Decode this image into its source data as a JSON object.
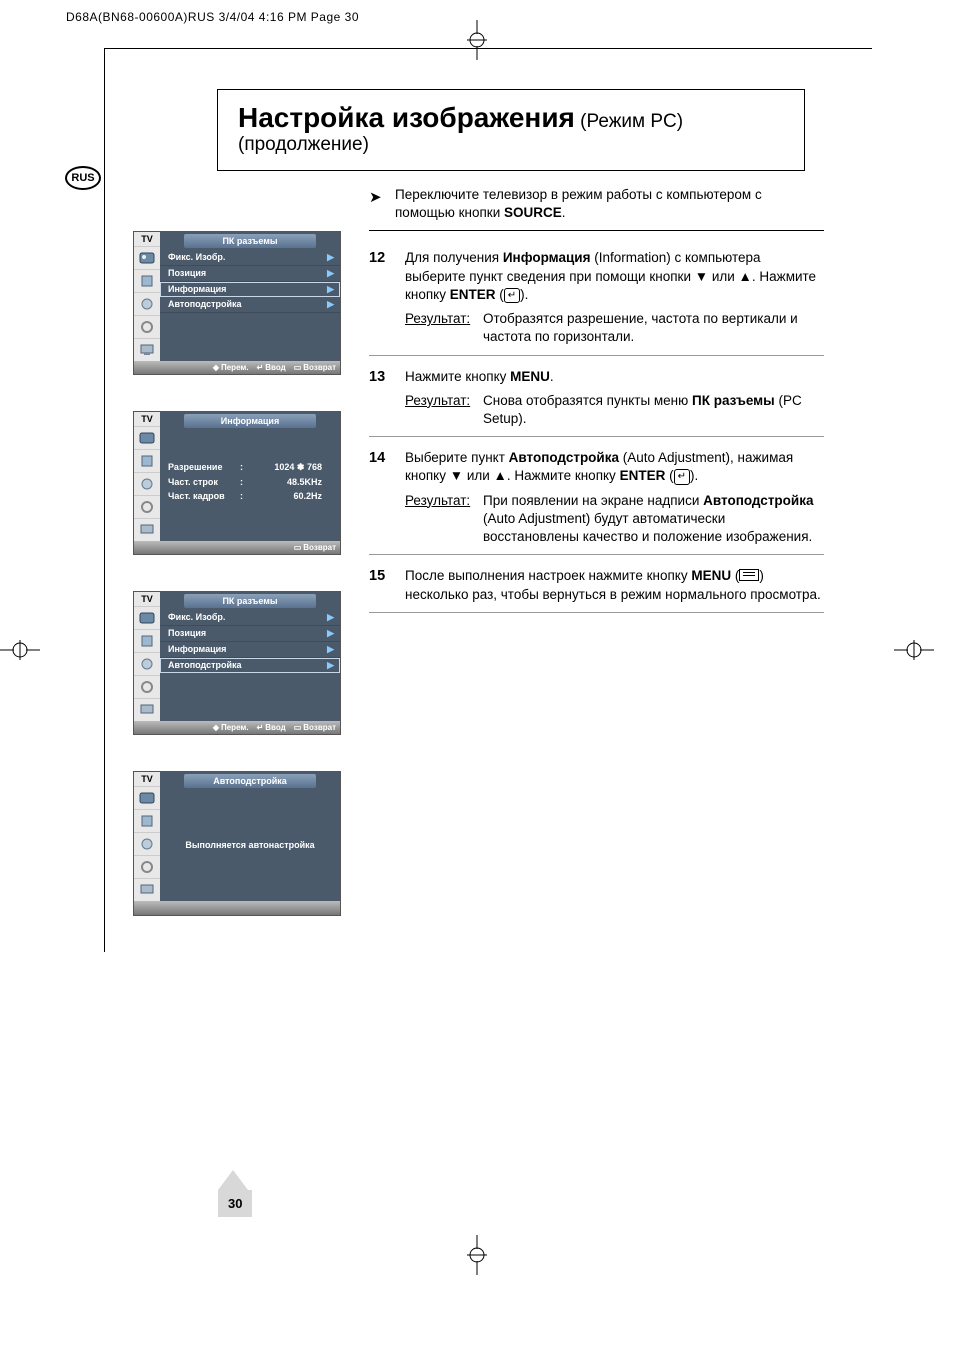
{
  "header_line": "D68A(BN68-00600A)RUS  3/4/04 4:16 PM  Page 30",
  "rus_badge": "RUS",
  "title_main": "Настройка изображения",
  "title_sub": " (Режим PC) (продолжение)",
  "top_note_pre": "Переключите телевизор в режим работы с компьютером с помощью кнопки ",
  "top_note_bold": "SOURCE",
  "top_note_post": ".",
  "steps": {
    "s12": {
      "num": "12",
      "t1": "Для получения ",
      "b1": "Информация",
      "t2": " (Information) с компьютера выберите пункт сведения при помощи кнопки ▼ или ▲. Нажмите кнопку ",
      "b2": "ENTER",
      "t3": " (",
      "t4": ").",
      "res_lbl": "Результат",
      "res_txt": "Отобразятся разрешение, частота по вертикали и частота по горизонтали."
    },
    "s13": {
      "num": "13",
      "t1": "Нажмите кнопку ",
      "b1": "MENU",
      "t2": ".",
      "res_lbl": "Результат",
      "res_t1": "Снова отобразятся пункты меню ",
      "res_b1": "ПК разъемы",
      "res_t2": " (PC Setup)."
    },
    "s14": {
      "num": "14",
      "t1": "Выберите пункт ",
      "b1": "Автоподстройка",
      "t2": " (Auto Adjustment), нажимая кнопку ▼ или ▲. Нажмите кнопку ",
      "b2": "ENTER",
      "t3": " (",
      "t4": ").",
      "res_lbl": "Результат",
      "res_t1": "При появлении на экране надписи ",
      "res_b1": "Автоподстройка",
      "res_t2": " (Auto Adjustment) будут автоматически восстановлены качество и положение изображения."
    },
    "s15": {
      "num": "15",
      "t1": "После выполнения настроек нажмите кнопку ",
      "b1": "MENU",
      "t2": " (",
      "t3": ") несколько раз, чтобы вернуться в режим нормального просмотра."
    }
  },
  "osd_tv": "TV",
  "osd1": {
    "title": "ПК разъемы",
    "rows": [
      "Фикс. Изобр.",
      "Позиция",
      "Информация",
      "Автоподстройка"
    ],
    "sel_index": 2,
    "bar": {
      "move": "Перем.",
      "enter": "Ввод",
      "ret": "Возврат"
    }
  },
  "osd2": {
    "title": "Информация",
    "rows": [
      {
        "k": "Разрешение",
        "v": "1024 ✽ 768"
      },
      {
        "k": "Част. строк",
        "v": "48.5KHz"
      },
      {
        "k": "Част. кадров",
        "v": "60.2Hz"
      }
    ],
    "bar": {
      "ret": "Возврат"
    }
  },
  "osd3": {
    "title": "ПК разъемы",
    "rows": [
      "Фикс. Изобр.",
      "Позиция",
      "Информация",
      "Автоподстройка"
    ],
    "sel_index": 3,
    "bar": {
      "move": "Перем.",
      "enter": "Ввод",
      "ret": "Возврат"
    }
  },
  "osd4": {
    "title": "Автоподстройка",
    "body": "Выполняется автонастройка"
  },
  "page_number": "30"
}
